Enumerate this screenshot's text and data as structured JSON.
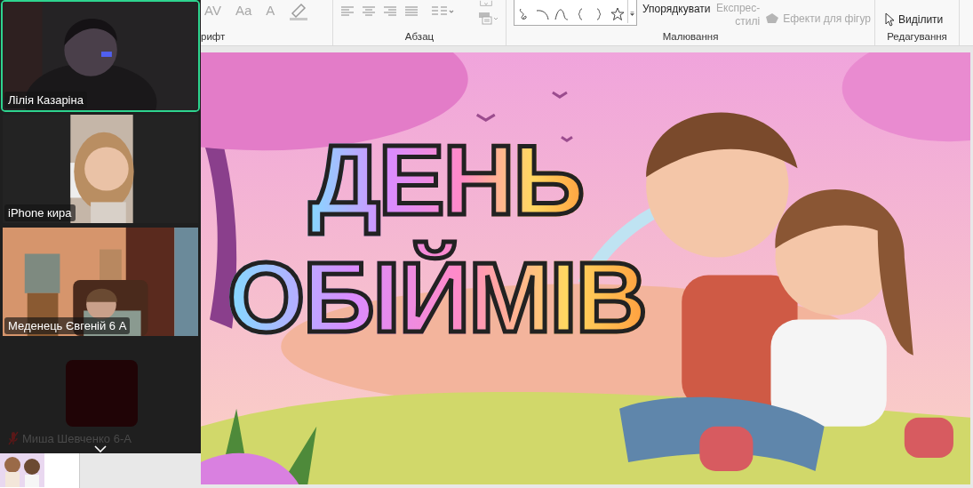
{
  "ribbon": {
    "groups": [
      {
        "kind": "font",
        "label": "рифт",
        "buttons": [
          {
            "label": "AV",
            "disabled": true
          },
          {
            "label": "Aa",
            "disabled": true
          },
          {
            "label": "A",
            "disabled": true
          }
        ]
      },
      {
        "kind": "paragraph",
        "label": "Абзац"
      },
      {
        "kind": "drawing",
        "label": "Малювання",
        "buttons": [
          {
            "label": "Упорядкувати",
            "disabled": false
          },
          {
            "label": "Експрес-стилі",
            "disabled": true
          },
          {
            "label": "Ефекти для фігур",
            "disabled": true
          }
        ]
      },
      {
        "kind": "editing",
        "label": "Редагування",
        "buttons": [
          {
            "label": "Виділити",
            "disabled": false
          }
        ]
      }
    ]
  },
  "participants": [
    {
      "name": "Лілія Казаріна",
      "active": true,
      "muted": false,
      "kind": "dark-room"
    },
    {
      "name": "iPhone кира",
      "active": false,
      "muted": false,
      "kind": "portrait"
    },
    {
      "name": "Меденець Євгеній 6 А",
      "active": false,
      "muted": false,
      "kind": "living-room"
    },
    {
      "name": "Миша Шевченко 6-А",
      "active": false,
      "muted": true,
      "kind": "no-video"
    }
  ],
  "slide": {
    "title_lines": [
      "ДЕНЬ",
      "ОБІЙМІВ"
    ]
  }
}
